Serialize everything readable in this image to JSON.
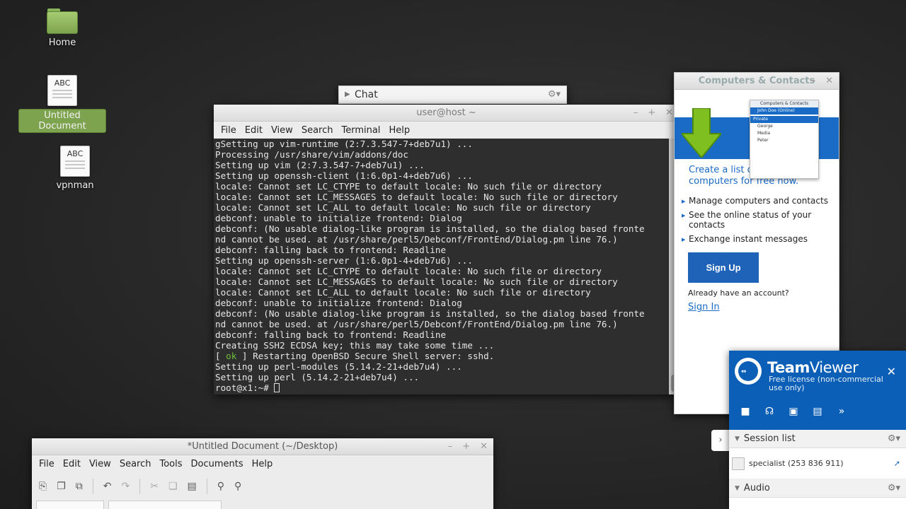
{
  "desktop": {
    "icons": [
      {
        "label": "Home"
      },
      {
        "label": "Untitled Document"
      },
      {
        "label": "vpnman"
      }
    ],
    "doc_glyph": "ABC"
  },
  "chat": {
    "label": "Chat",
    "gear": "⚙▾"
  },
  "terminal": {
    "title": "user@host ~",
    "menu": [
      "File",
      "Edit",
      "View",
      "Search",
      "Terminal",
      "Help"
    ],
    "lines": [
      "gSetting up vim-runtime (2:7.3.547-7+deb7u1) ...",
      "Processing /usr/share/vim/addons/doc",
      "Setting up vim (2:7.3.547-7+deb7u1) ...",
      "Setting up openssh-client (1:6.0p1-4+deb7u6) ...",
      "locale: Cannot set LC_CTYPE to default locale: No such file or directory",
      "locale: Cannot set LC_MESSAGES to default locale: No such file or directory",
      "locale: Cannot set LC_ALL to default locale: No such file or directory",
      "debconf: unable to initialize frontend: Dialog",
      "debconf: (No usable dialog-like program is installed, so the dialog based fronte",
      "nd cannot be used. at /usr/share/perl5/Debconf/FrontEnd/Dialog.pm line 76.)",
      "debconf: falling back to frontend: Readline",
      "Setting up openssh-server (1:6.0p1-4+deb7u6) ...",
      "locale: Cannot set LC_CTYPE to default locale: No such file or directory",
      "locale: Cannot set LC_MESSAGES to default locale: No such file or directory",
      "locale: Cannot set LC_ALL to default locale: No such file or directory",
      "debconf: unable to initialize frontend: Dialog",
      "debconf: (No usable dialog-like program is installed, so the dialog based fronte",
      "nd cannot be used. at /usr/share/perl5/Debconf/FrontEnd/Dialog.pm line 76.)",
      "debconf: falling back to frontend: Readline",
      "Creating SSH2 ECDSA key; this may take some time ..."
    ],
    "ok_line": {
      "open": "[ ",
      "ok": "ok",
      "rest": " ] Restarting OpenBSD Secure Shell server: sshd."
    },
    "lines_after": [
      "Setting up perl-modules (5.14.2-21+deb7u4) ...",
      "Setting up perl (5.14.2-21+deb7u4) ..."
    ],
    "prompt": "root@x1:~# "
  },
  "contacts": {
    "title": "Computers & Contacts",
    "mini": {
      "title": "Computers & Contacts",
      "user": "John Doe (Online)",
      "group": "Private",
      "entries": [
        "George",
        "Media",
        "Peter"
      ]
    },
    "pitch": "Create a list of your computers for free now.",
    "features": [
      "Manage computers and contacts",
      "See the online status of your contacts",
      "Exchange instant messages"
    ],
    "signup": "Sign Up",
    "already": "Already have an account?",
    "signin": "Sign In"
  },
  "teamviewer": {
    "brand_bold": "Team",
    "brand_light": "Viewer",
    "subtitle": "Free license (non-commercial use only)",
    "session_header": "Session list",
    "session_item": "specialist (253 836 911)",
    "audio_header": "Audio"
  },
  "gedit": {
    "title": "*Untitled Document (~/Desktop)",
    "menu": [
      "File",
      "Edit",
      "View",
      "Search",
      "Tools",
      "Documents",
      "Help"
    ]
  }
}
